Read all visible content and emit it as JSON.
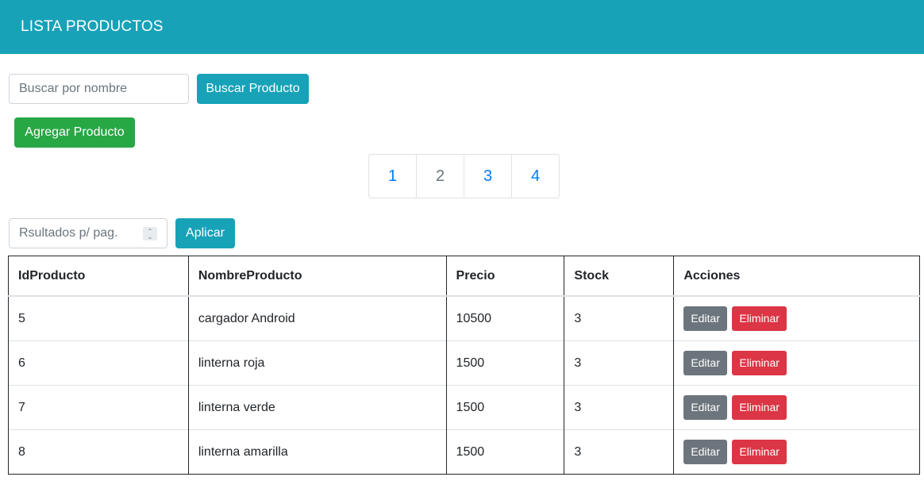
{
  "header": {
    "title": "LISTA PRODUCTOS"
  },
  "search": {
    "placeholder": "Buscar por nombre",
    "value": "",
    "button_label": "Buscar Producto"
  },
  "add_button_label": "Agregar Producto",
  "pagination": {
    "pages": [
      "1",
      "2",
      "3",
      "4"
    ],
    "current": "2"
  },
  "page_size": {
    "placeholder": "Rsultados p/ pag.",
    "button_label": "Aplicar"
  },
  "table": {
    "headers": [
      "IdProducto",
      "NombreProducto",
      "Precio",
      "Stock",
      "Acciones"
    ],
    "rows": [
      {
        "id": "5",
        "name": "cargador Android",
        "price": "10500",
        "stock": "3"
      },
      {
        "id": "6",
        "name": "linterna roja",
        "price": "1500",
        "stock": "3"
      },
      {
        "id": "7",
        "name": "linterna verde",
        "price": "1500",
        "stock": "3"
      },
      {
        "id": "8",
        "name": "linterna amarilla",
        "price": "1500",
        "stock": "3"
      }
    ],
    "actions": {
      "edit_label": "Editar",
      "delete_label": "Eliminar"
    }
  },
  "colors": {
    "primary": "#17a2b8",
    "success": "#28a745",
    "secondary": "#6c757d",
    "danger": "#dc3545",
    "link": "#007bff"
  }
}
